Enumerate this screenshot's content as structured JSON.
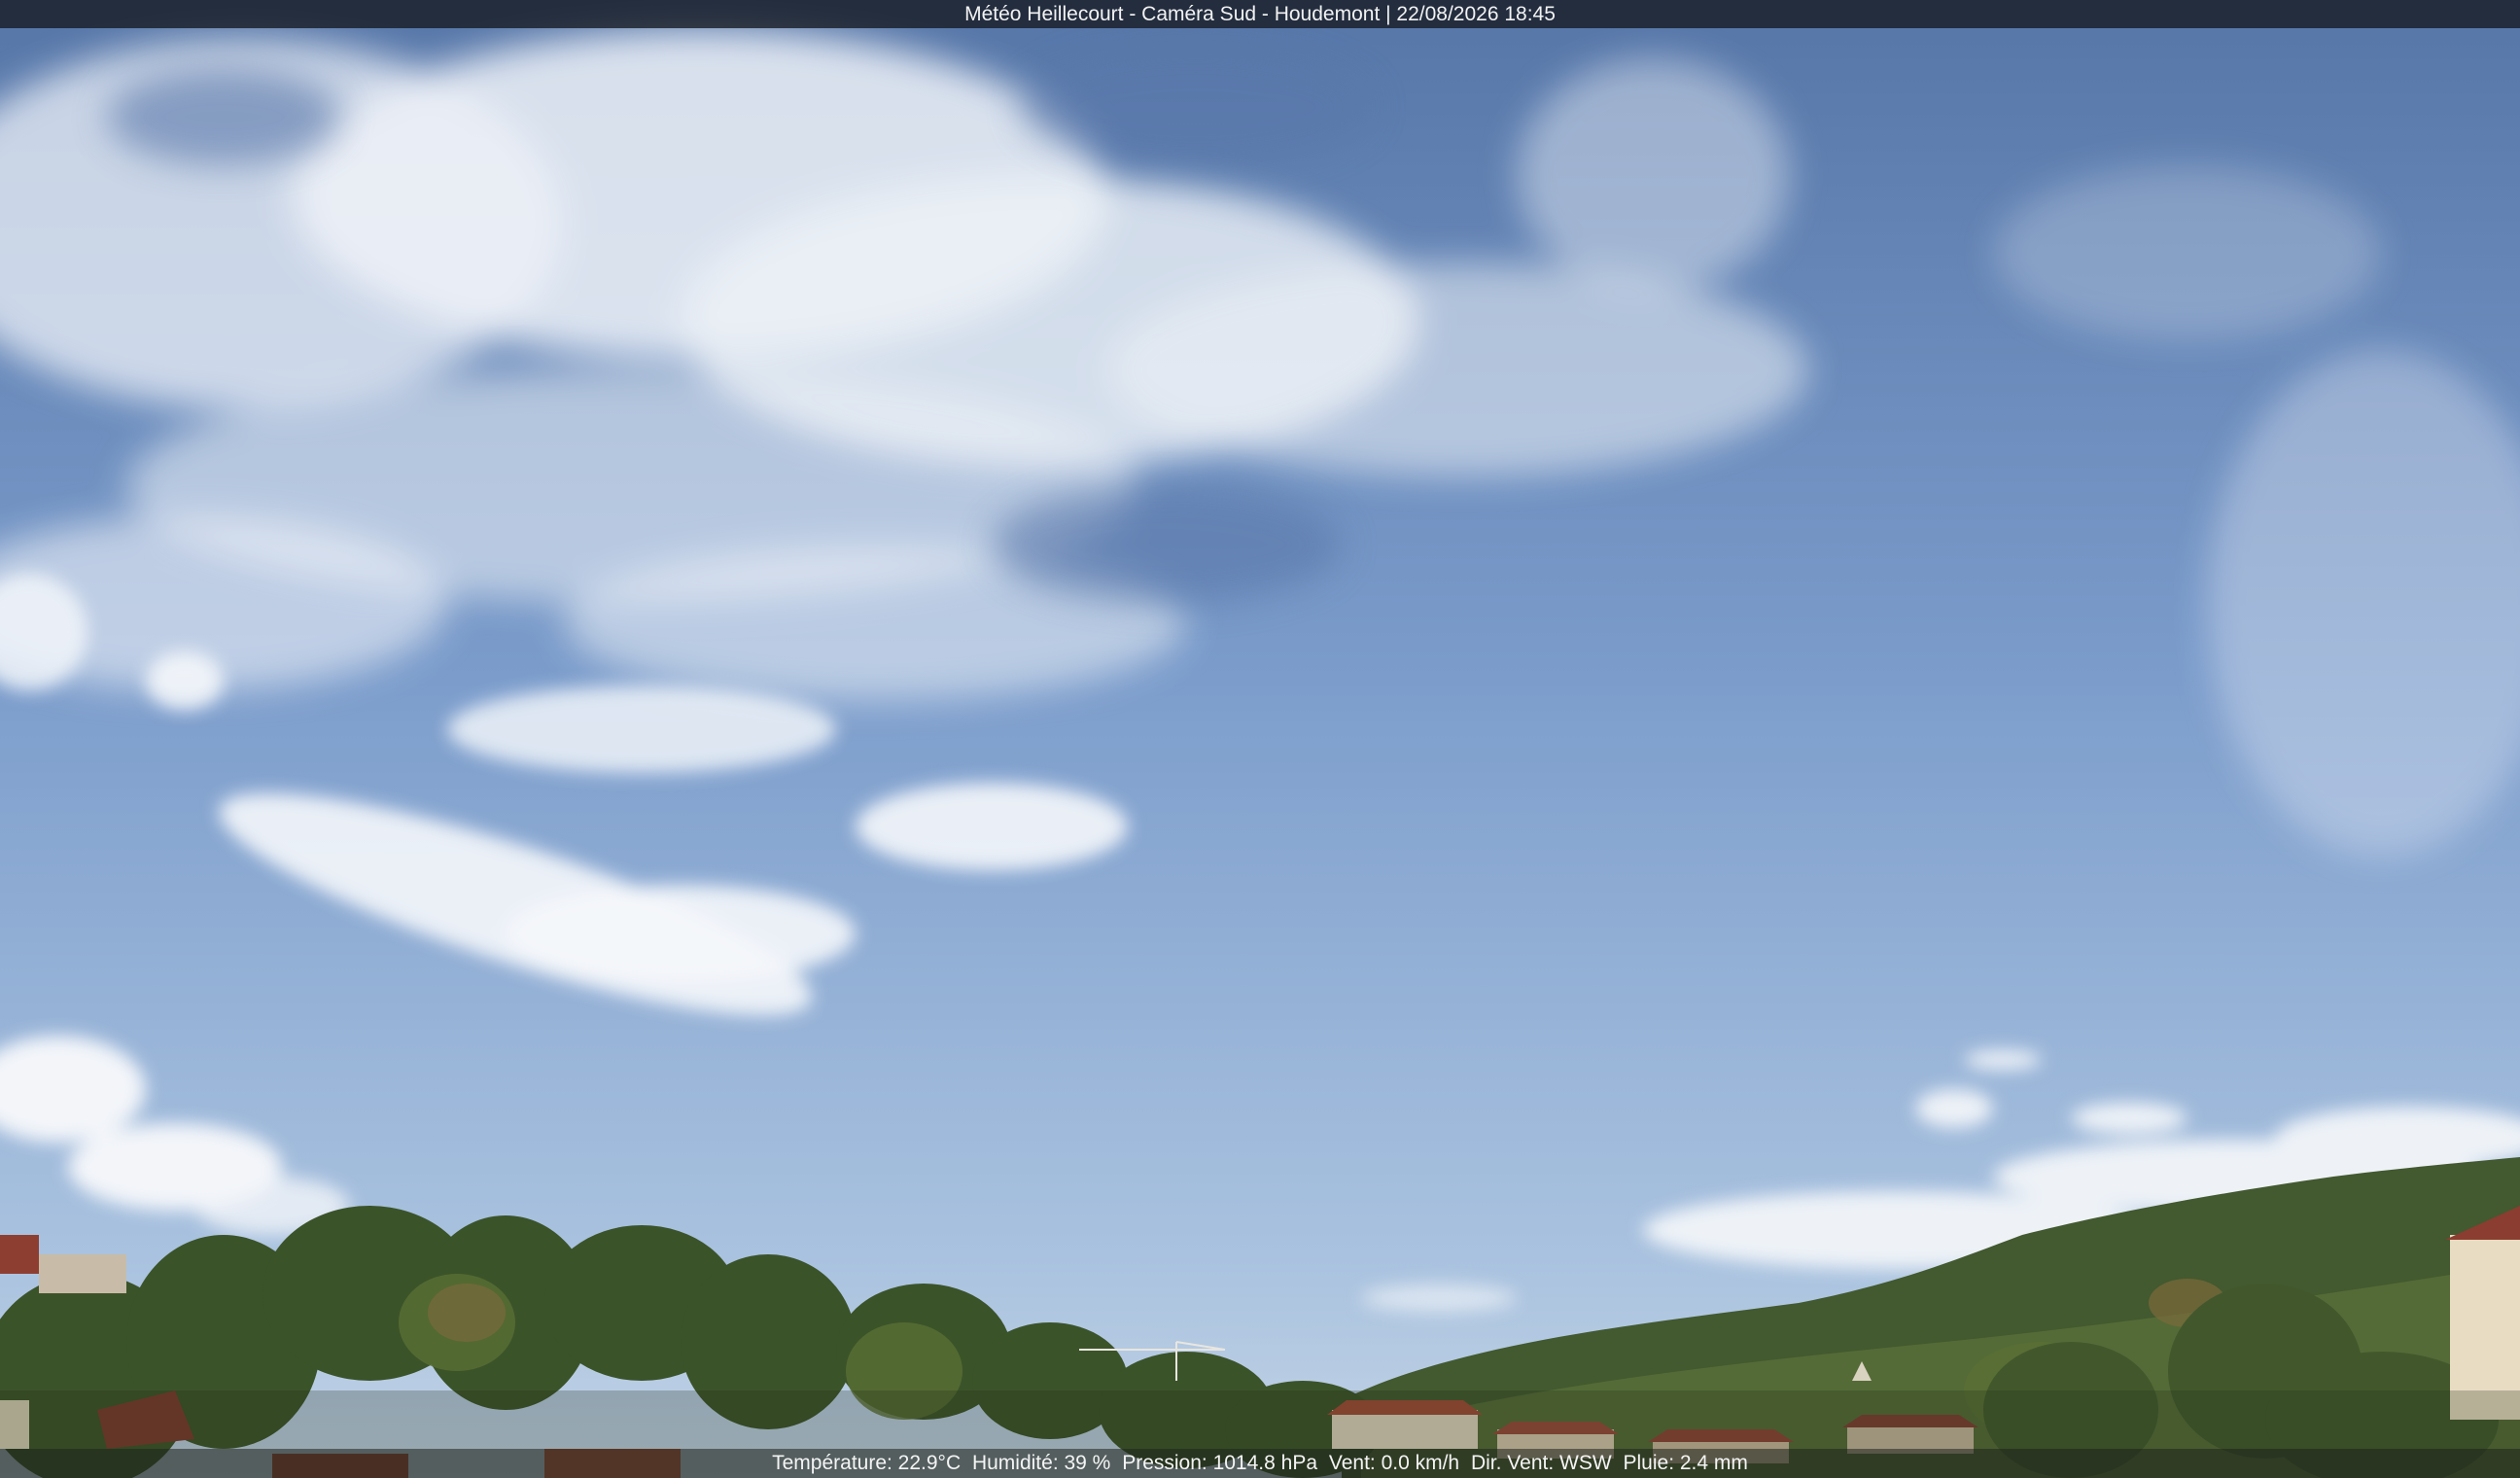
{
  "overlay_title": "Météo Heillecourt - Caméra Sud - Houdemont | 22/08/2026 18:45",
  "weather": {
    "temperature": "Température: 22.9°C",
    "humidity": "Humidité: 39 %",
    "pressure": "Pression: 1014.8 hPa",
    "wind_speed": "Vent: 0.0 km/h",
    "wind_dir": "Dir. Vent: WSW",
    "rain": "Pluie: 2.4 mm"
  },
  "colors": {
    "sky_top": "#5f7fb0",
    "sky_bottom": "#b9cfe6",
    "cloud": "#f4f6fa",
    "foliage": "#3e5a2c",
    "roof": "#9a4a3a"
  }
}
